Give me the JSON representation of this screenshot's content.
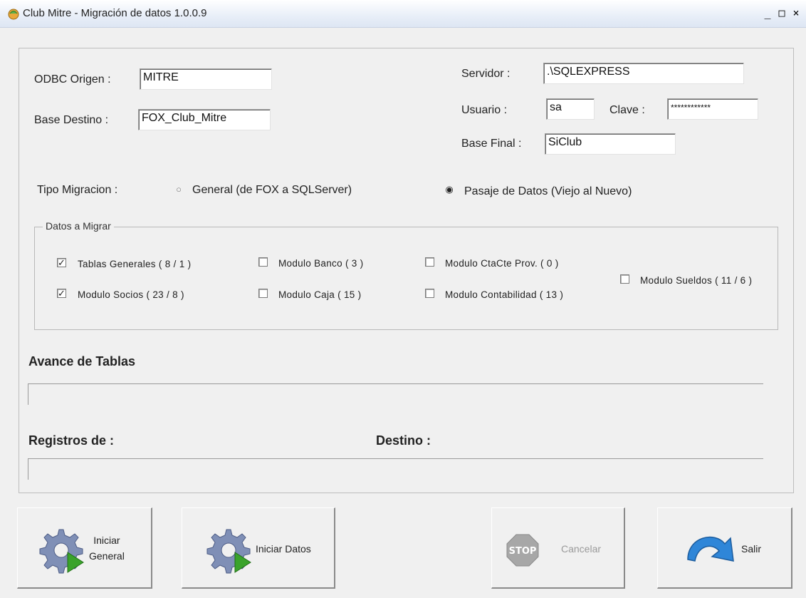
{
  "window": {
    "title": "Club Mitre - Migración de datos 1.0.0.9",
    "minimize": "_",
    "maximize": "□",
    "close": "×"
  },
  "connection": {
    "odbc_label": "ODBC Origen :",
    "odbc_value": "MITRE",
    "base_destino_label": "Base Destino :",
    "base_destino_value": "FOX_Club_Mitre",
    "servidor_label": "Servidor :",
    "servidor_value": ".\\SQLEXPRESS",
    "usuario_label": "Usuario :",
    "usuario_value": "sa",
    "clave_label": "Clave :",
    "clave_value": "************",
    "base_final_label": "Base Final :",
    "base_final_value": "SiClub"
  },
  "migracion": {
    "label": "Tipo Migracion :",
    "options": [
      {
        "label": "General (de FOX a SQLServer)",
        "selected": false
      },
      {
        "label": "Pasaje de Datos (Viejo al Nuevo)",
        "selected": true
      }
    ]
  },
  "datos": {
    "group_title": "Datos a Migrar",
    "items": [
      {
        "label": "Tablas Generales  ( 8 / 1 )",
        "checked": true
      },
      {
        "label": "Modulo Socios ( 23 / 8 )",
        "checked": true
      },
      {
        "label": "Modulo Banco ( 3 )",
        "checked": false
      },
      {
        "label": "Modulo Caja ( 15 )",
        "checked": false
      },
      {
        "label": "Modulo CtaCte Prov. ( 0 )",
        "checked": false
      },
      {
        "label": "Modulo Contabilidad ( 13 )",
        "checked": false
      },
      {
        "label": "Modulo Sueldos ( 11 / 6 )",
        "checked": false
      }
    ]
  },
  "progress": {
    "avance_label": "Avance de Tablas",
    "registros_label": "Registros de :",
    "destino_label": "Destino :",
    "avance_value": 0,
    "registros_value": 0
  },
  "buttons": {
    "iniciar_general_line1": "Iniciar",
    "iniciar_general_line2": "General",
    "iniciar_datos": "Iniciar Datos",
    "stop_badge": "STOP",
    "cancelar": "Cancelar",
    "salir": "Salir"
  },
  "colors": {
    "accent_blue": "#2f86d8",
    "gear": "#7f8fb6",
    "play_green": "#3aa32b",
    "stop_gray": "#a7a7a7"
  }
}
